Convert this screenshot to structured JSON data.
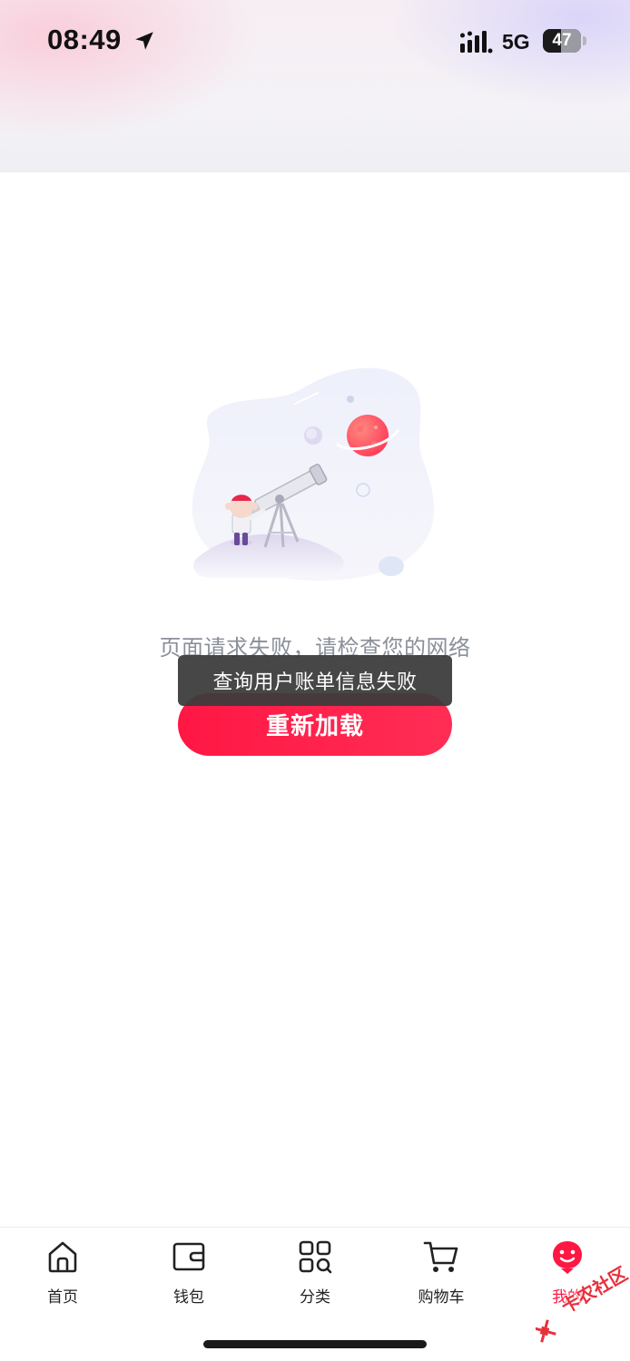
{
  "status_bar": {
    "time": "08:49",
    "network": "5G",
    "battery_level": "47"
  },
  "error": {
    "message": "页面请求失败，请检查您的网络",
    "reload_label": "重新加载"
  },
  "toast": {
    "message": "查询用户账单信息失败"
  },
  "tabbar": {
    "items": [
      {
        "label": "首页",
        "icon": "home-icon"
      },
      {
        "label": "钱包",
        "icon": "wallet-icon"
      },
      {
        "label": "分类",
        "icon": "category-icon"
      },
      {
        "label": "购物车",
        "icon": "cart-icon"
      },
      {
        "label": "我的",
        "icon": "profile-icon",
        "active": true
      }
    ]
  },
  "watermark": {
    "text": "卡农社区"
  },
  "colors": {
    "accent": "#ff1744",
    "text_muted": "#8a8f99",
    "toast_bg": "#3c3c3c"
  }
}
